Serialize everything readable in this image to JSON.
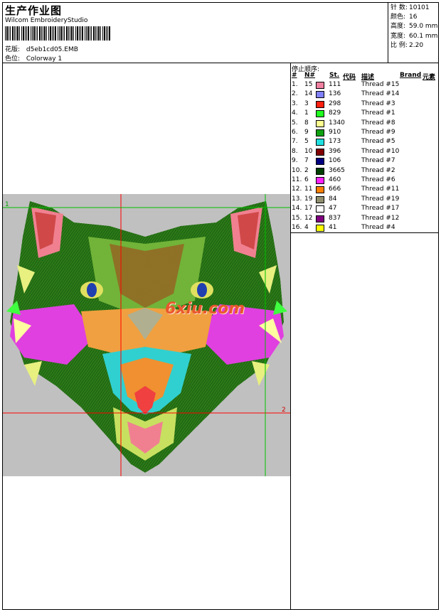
{
  "header": {
    "title": "生产作业图",
    "software": "Wilcom EmbroideryStudio",
    "design_label": "花版:",
    "design_file": "d5eb1cd05.EMB",
    "colorway_label": "色位:",
    "colorway": "Colorway 1"
  },
  "stats": [
    {
      "label": "针 数:",
      "value": "10101"
    },
    {
      "label": "颜色:",
      "value": "16"
    },
    {
      "label": "高度:",
      "value": "59.0 mm"
    },
    {
      "label": "宽度:",
      "value": "60.1 mm"
    },
    {
      "label": "比 例:",
      "value": "2.20"
    }
  ],
  "sequence": {
    "title": "停止顺序:",
    "headers": {
      "num": "#",
      "n": "N#",
      "st": "St.",
      "code": "代码",
      "desc": "描述",
      "brand": "Brand",
      "element": "元素"
    },
    "rows": [
      {
        "idx": "1.",
        "n": "15",
        "color": "#f080a0",
        "st": "111",
        "desc": "Thread #15"
      },
      {
        "idx": "2.",
        "n": "14",
        "color": "#8080ff",
        "st": "136",
        "desc": "Thread #14"
      },
      {
        "idx": "3.",
        "n": "3",
        "color": "#ff2010",
        "st": "298",
        "desc": "Thread #3"
      },
      {
        "idx": "4.",
        "n": "1",
        "color": "#20ff20",
        "st": "829",
        "desc": "Thread #1"
      },
      {
        "idx": "5.",
        "n": "8",
        "color": "#ffff90",
        "st": "1340",
        "desc": "Thread #8"
      },
      {
        "idx": "6.",
        "n": "9",
        "color": "#10a010",
        "st": "910",
        "desc": "Thread #9"
      },
      {
        "idx": "7.",
        "n": "5",
        "color": "#20e0e0",
        "st": "173",
        "desc": "Thread #5"
      },
      {
        "idx": "8.",
        "n": "10",
        "color": "#800000",
        "st": "396",
        "desc": "Thread #10"
      },
      {
        "idx": "9.",
        "n": "7",
        "color": "#000080",
        "st": "106",
        "desc": "Thread #7"
      },
      {
        "idx": "10.",
        "n": "2",
        "color": "#004000",
        "st": "3665",
        "desc": "Thread #2"
      },
      {
        "idx": "11.",
        "n": "6",
        "color": "#ff20ff",
        "st": "460",
        "desc": "Thread #6"
      },
      {
        "idx": "12.",
        "n": "11",
        "color": "#ff8000",
        "st": "666",
        "desc": "Thread #11"
      },
      {
        "idx": "13.",
        "n": "19",
        "color": "#909070",
        "st": "84",
        "desc": "Thread #19"
      },
      {
        "idx": "14.",
        "n": "17",
        "color": "#ffffff",
        "st": "47",
        "desc": "Thread #17"
      },
      {
        "idx": "15.",
        "n": "12",
        "color": "#800080",
        "st": "837",
        "desc": "Thread #12"
      },
      {
        "idx": "16.",
        "n": "4",
        "color": "#ffff00",
        "st": "41",
        "desc": "Thread #4"
      }
    ]
  },
  "design": {
    "watermark": "6xiu.com",
    "marker_start": "1",
    "marker_end": "2",
    "background": "#c0c0c0"
  }
}
